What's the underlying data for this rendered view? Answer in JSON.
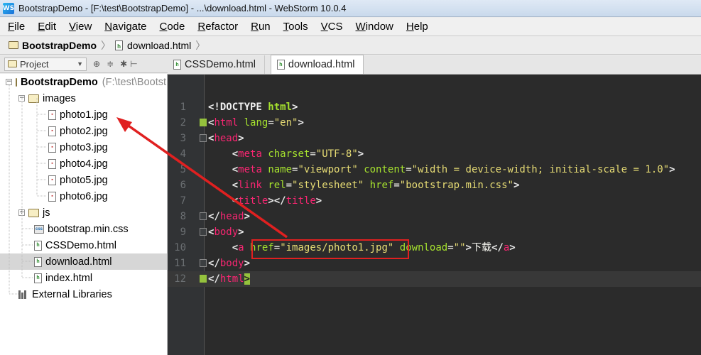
{
  "window": {
    "title": "BootstrapDemo - [F:\\test\\BootstrapDemo] - ...\\download.html - WebStorm 10.0.4"
  },
  "menu": [
    "File",
    "Edit",
    "View",
    "Navigate",
    "Code",
    "Refactor",
    "Run",
    "Tools",
    "VCS",
    "Window",
    "Help"
  ],
  "breadcrumb": {
    "project": "BootstrapDemo",
    "file": "download.html"
  },
  "project_panel": {
    "dropdown_label": "Project",
    "root": {
      "name": "BootstrapDemo",
      "path": "(F:\\test\\BootstrapDemo)"
    },
    "images_folder": "images",
    "images": [
      "photo1.jpg",
      "photo2.jpg",
      "photo3.jpg",
      "photo4.jpg",
      "photo5.jpg",
      "photo6.jpg"
    ],
    "js_folder": "js",
    "files": [
      "bootstrap.min.css",
      "CSSDemo.html",
      "download.html",
      "index.html"
    ],
    "selected_file": "download.html",
    "external_libraries": "External Libraries"
  },
  "tabs": [
    {
      "label": "CSSDemo.html",
      "active": false
    },
    {
      "label": "download.html",
      "active": true
    }
  ],
  "editor": {
    "current_line": 12,
    "lines": [
      {
        "n": "1",
        "code": "<!DOCTYPE html>"
      },
      {
        "n": "2",
        "code": "<html lang=\"en\">"
      },
      {
        "n": "3",
        "code": "<head>"
      },
      {
        "n": "4",
        "code": "    <meta charset=\"UTF-8\">"
      },
      {
        "n": "5",
        "code": "    <meta name=\"viewport\" content=\"width = device-width; initial-scale = 1.0\">"
      },
      {
        "n": "6",
        "code": "    <link rel=\"stylesheet\" href=\"bootstrap.min.css\">"
      },
      {
        "n": "7",
        "code": "    <title></title>"
      },
      {
        "n": "8",
        "code": "</head>"
      },
      {
        "n": "9",
        "code": "<body>"
      },
      {
        "n": "10",
        "code": "    <a href=\"images/photo1.jpg\" download=\"\">下载</a>"
      },
      {
        "n": "11",
        "code": "</body>"
      },
      {
        "n": "12",
        "code": "</html>"
      }
    ]
  },
  "colors": {
    "editor_bg": "#2b2b2b",
    "tag": "#f92672",
    "attr": "#a6e22e",
    "string": "#e6db74",
    "annotation": "#e02020"
  }
}
